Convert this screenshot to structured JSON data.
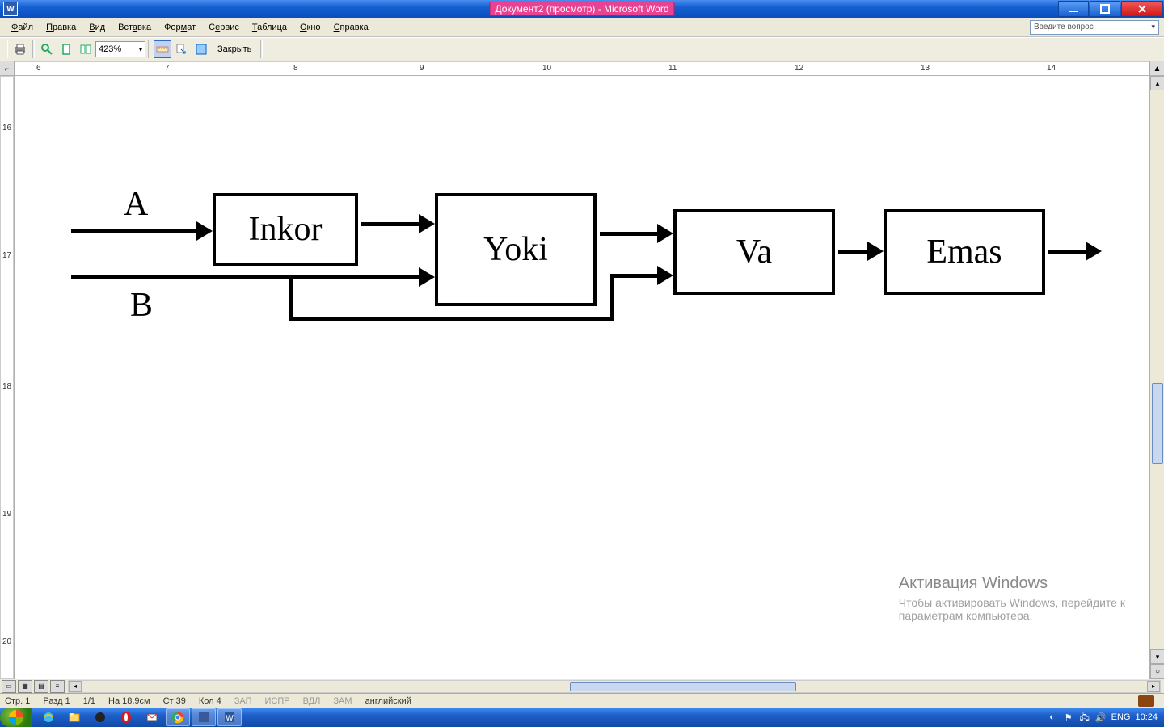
{
  "titlebar": {
    "title": "Документ2 (просмотр) - Microsoft Word"
  },
  "menubar": {
    "items": [
      "Файл",
      "Правка",
      "Вид",
      "Вставка",
      "Формат",
      "Сервис",
      "Таблица",
      "Окно",
      "Справка"
    ],
    "help_placeholder": "Введите вопрос"
  },
  "toolbar": {
    "zoom": "423%",
    "close_label": "Закрыть"
  },
  "ruler_h": {
    "numbers": [
      "6",
      "7",
      "8",
      "9",
      "10",
      "11",
      "12",
      "13",
      "14"
    ]
  },
  "ruler_v": {
    "numbers": [
      "16",
      "17",
      "18",
      "19",
      "20"
    ]
  },
  "diagram": {
    "input_a": "A",
    "input_b": "B",
    "box1": "Inkor",
    "box2": "Yoki",
    "box3": "Va",
    "box4": "Emas"
  },
  "statusbar": {
    "page": "Стр. 1",
    "section": "Разд 1",
    "pages": "1/1",
    "position": "На 18,9см",
    "line": "Ст 39",
    "column": "Кол 4",
    "rec": "ЗАП",
    "trk": "ИСПР",
    "ext": "ВДЛ",
    "ovr": "ЗАМ",
    "lang": "английский"
  },
  "taskbar": {
    "lang": "ENG",
    "time": "10:24"
  },
  "watermark": {
    "title": "Активация Windows",
    "line1": "Чтобы активировать Windows, перейдите к",
    "line2": "параметрам компьютера."
  }
}
